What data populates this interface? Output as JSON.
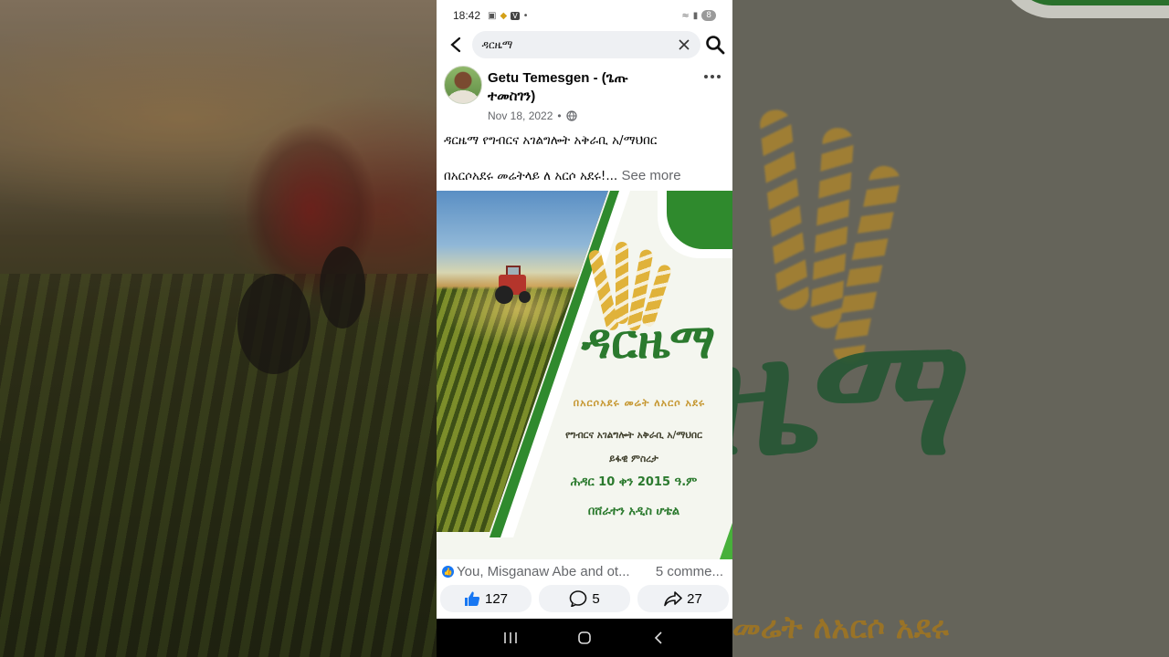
{
  "statusbar": {
    "time": "18:42",
    "battery": "8",
    "icons": [
      "screenshot-icon",
      "binance-icon",
      "vpn-icon",
      "dot-icon",
      "wifi-icon",
      "signal-icon"
    ]
  },
  "search": {
    "query": "ዳርዜማ"
  },
  "post": {
    "author": "Getu Temesgen - (ጌጡ ተመስገን)",
    "date": "Nov 18, 2022",
    "separator": "•",
    "privacy_icon": "globe-icon",
    "line1": "ዳርዜማ የግብርና አገልግሎት አቅራቢ አ/ማህበር",
    "line2": "በአርሶአደሩ መሬትላይ ለ አርሶ አደሩ!...",
    "see_more": "See more"
  },
  "poster": {
    "title": "ዳርዜማ",
    "tagline": "በአርሶአደሩ መሬት ለአርሶ አደሩ",
    "organization": "የግብርና አገልግሎት አቅራቢ አ/ማህበር",
    "event": "ይፋዊ ምስረታ",
    "date": "ሕዳር 10 ቀን 2015 ዓ.ም",
    "venue": "በሸራተን አዲስ ሆቴል"
  },
  "reactions": {
    "names": "You, Misganaw Abe and ot...",
    "comments": "5 comme...",
    "like_count": "127",
    "comment_count": "5",
    "share_count": "27"
  },
  "backdrop": {
    "title": "ዜማ",
    "subtitle": "መሬት ለአርሶ አደሩ"
  },
  "colors": {
    "brand_green": "#2b7a2e",
    "gold": "#c5962f",
    "facebook_blue": "#1877f2"
  }
}
